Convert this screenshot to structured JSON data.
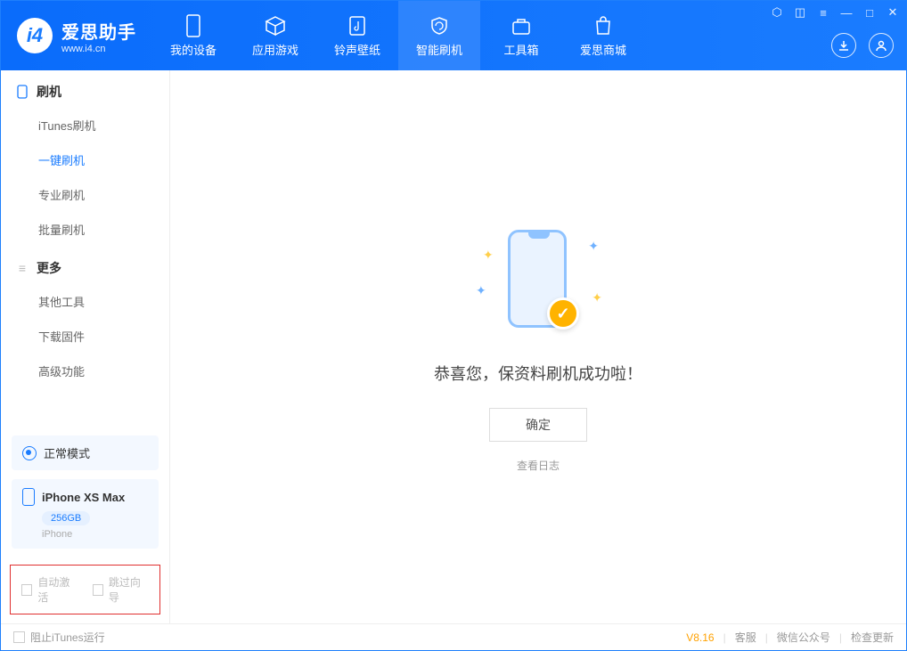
{
  "brand": {
    "title": "爱思助手",
    "subtitle": "www.i4.cn"
  },
  "tabs": [
    {
      "label": "我的设备"
    },
    {
      "label": "应用游戏"
    },
    {
      "label": "铃声壁纸"
    },
    {
      "label": "智能刷机"
    },
    {
      "label": "工具箱"
    },
    {
      "label": "爱思商城"
    }
  ],
  "sidebar": {
    "group1": {
      "title": "刷机",
      "items": [
        "iTunes刷机",
        "一键刷机",
        "专业刷机",
        "批量刷机"
      ]
    },
    "group2": {
      "title": "更多",
      "items": [
        "其他工具",
        "下载固件",
        "高级功能"
      ]
    },
    "mode": "正常模式",
    "device": {
      "name": "iPhone XS Max",
      "storage": "256GB",
      "type": "iPhone"
    },
    "checkbox1": "自动激活",
    "checkbox2": "跳过向导"
  },
  "main": {
    "message": "恭喜您，保资料刷机成功啦！",
    "ok": "确定",
    "loglink": "查看日志"
  },
  "footer": {
    "block_itunes": "阻止iTunes运行",
    "version": "V8.16",
    "link1": "客服",
    "link2": "微信公众号",
    "link3": "检查更新"
  }
}
